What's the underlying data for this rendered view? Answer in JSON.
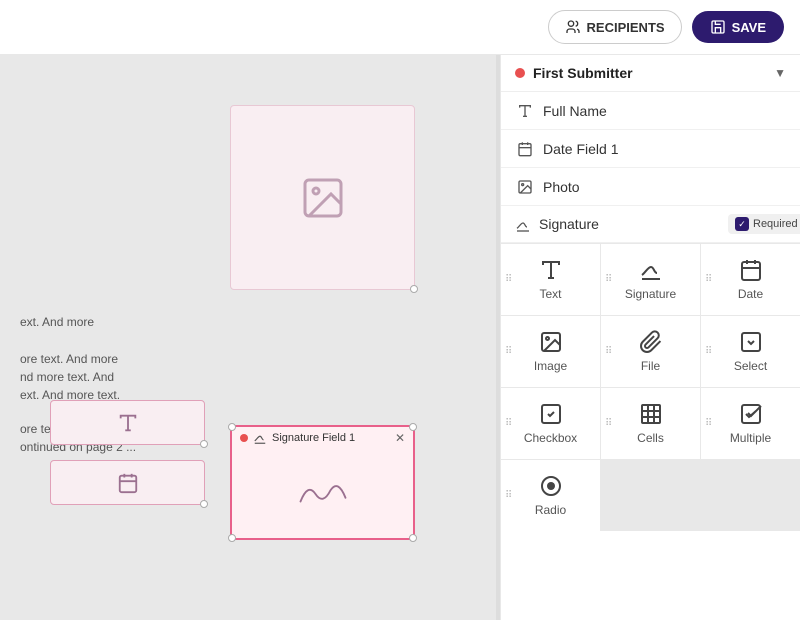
{
  "header": {
    "recipients_label": "RECIPIENTS",
    "save_label": "SAVE"
  },
  "submitter": {
    "label": "First Submitter"
  },
  "fields": [
    {
      "icon": "text-icon",
      "label": "Full Name"
    },
    {
      "icon": "date-icon",
      "label": "Date Field 1"
    },
    {
      "icon": "photo-icon",
      "label": "Photo"
    }
  ],
  "signature_field": {
    "label": "Signature",
    "required_label": "Required"
  },
  "field_types": [
    {
      "icon": "text-type-icon",
      "label": "Text"
    },
    {
      "icon": "signature-type-icon",
      "label": "Signature"
    },
    {
      "icon": "date-type-icon",
      "label": "Date"
    },
    {
      "icon": "image-type-icon",
      "label": "Image"
    },
    {
      "icon": "file-type-icon",
      "label": "File"
    },
    {
      "icon": "select-type-icon",
      "label": "Select"
    },
    {
      "icon": "checkbox-type-icon",
      "label": "Checkbox"
    },
    {
      "icon": "cells-type-icon",
      "label": "Cells"
    },
    {
      "icon": "multiple-type-icon",
      "label": "Multiple"
    },
    {
      "icon": "radio-type-icon",
      "label": "Radio"
    }
  ],
  "canvas": {
    "text1": "ext. And more",
    "text2_line1": "ore text. And more",
    "text2_line2": "nd more text. And",
    "text2_line3": "ext. And more text.",
    "text3_line1": "ore text. And more",
    "text3_line2": "ontinued on page 2 ...",
    "signature_field_label": "Signature Field 1"
  }
}
